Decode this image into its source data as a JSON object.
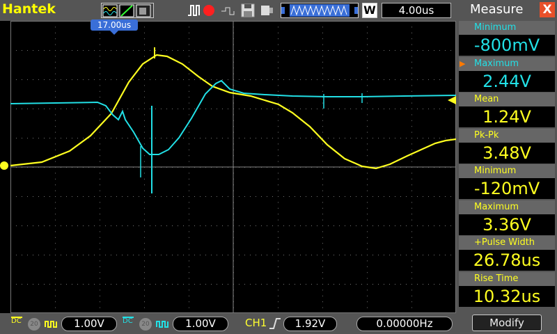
{
  "brand": "Hantek",
  "timebase": "4.00us",
  "trigger_position": "17.00us",
  "measure": {
    "title": "Measure",
    "close": "X",
    "items": [
      {
        "label": "Minimum",
        "value": "-800mV",
        "channel": "CH2",
        "color": "#22e0e6",
        "selected": false
      },
      {
        "label": "Maximum",
        "value": "2.44V",
        "channel": "CH2",
        "color": "#22e0e6",
        "selected": true
      },
      {
        "label": "Mean",
        "value": "1.24V",
        "channel": "CH1",
        "color": "#ffff20",
        "selected": false
      },
      {
        "label": "Pk-Pk",
        "value": "3.48V",
        "channel": "CH1",
        "color": "#ffff20",
        "selected": false
      },
      {
        "label": "Minimum",
        "value": "-120mV",
        "channel": "CH1",
        "color": "#ffff20",
        "selected": false
      },
      {
        "label": "Maximum",
        "value": "3.36V",
        "channel": "CH1",
        "color": "#ffff20",
        "selected": false
      },
      {
        "label": "+Pulse Width",
        "value": "26.78us",
        "channel": "CH1",
        "color": "#ffff20",
        "selected": false
      },
      {
        "label": "Rise Time",
        "value": "10.32us",
        "channel": "CH1",
        "color": "#ffff20",
        "selected": false
      }
    ],
    "modify_label": "Modify"
  },
  "bottom": {
    "ch1_volts": "1.00V",
    "ch2_volts": "1.00V",
    "trigger_source": "CH1",
    "trigger_level": "1.92V",
    "frequency": "0.00000Hz",
    "dc_label": "DC",
    "bw_label": "20"
  },
  "icons": [
    "waveform-mode-icon",
    "run-stop-icon",
    "save-icon",
    "usb-icon",
    "memory-depth-icon",
    "trigger-edge-icon"
  ],
  "colors": {
    "ch1": "#ffff20",
    "ch2": "#22e0e6",
    "panel": "#555555",
    "accent": "#e8502a"
  }
}
